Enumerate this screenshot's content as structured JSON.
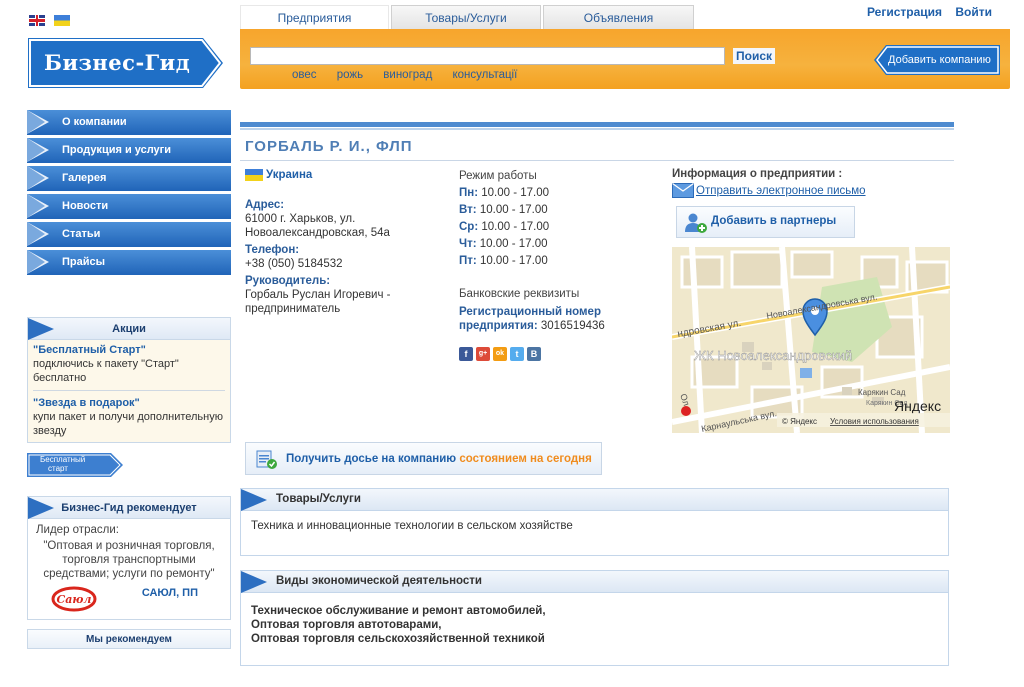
{
  "brand": {
    "name": "Бизнес-Гид"
  },
  "tabs": [
    {
      "label": "Предприятия",
      "active": true
    },
    {
      "label": "Товары/Услуги",
      "active": false
    },
    {
      "label": "Объявления",
      "active": false
    }
  ],
  "top_links": {
    "register": "Регистрация",
    "login": "Войти"
  },
  "search": {
    "value": "",
    "button": "Поиск",
    "hints": [
      "овес",
      "рожь",
      "виноград",
      "консультації"
    ]
  },
  "add_company": "Добавить компанию",
  "menu": [
    "О компании",
    "Продукция и услуги",
    "Галерея",
    "Новости",
    "Статьи",
    "Прайсы"
  ],
  "promos": {
    "title": "Акции",
    "items": [
      {
        "title": "\"Бесплатный Старт\"",
        "text": "подключись к пакету \"Старт\" бесплатно"
      },
      {
        "title": "\"Звезда в подарок\"",
        "text": "купи пакет и получи дополнительную звезду"
      }
    ]
  },
  "free_start": {
    "line1": "Бесплатный",
    "line2": "старт"
  },
  "recommends": {
    "title": "Бизнес-Гид рекомендует",
    "leader": "Лидер отрасли:",
    "quote": "\"Оптовая и розничная торговля, торговля транспортными средствами; услуги по ремонту\"",
    "company": "САЮЛ, ПП",
    "logo_text": "Саюл"
  },
  "we_recommend": "Мы рекомендуем",
  "company": {
    "title": "ГОРБАЛЬ Р. И., ФЛП",
    "country": "Украина",
    "address_label": "Адрес:",
    "address": "61000 г. Харьков, ул. Новоалександровская, 54а",
    "phone_label": "Телефон:",
    "phone": "+38 (050) 5184532",
    "head_label": "Руководитель:",
    "head": "Горбаль Руслан Игоревич - предприниматель"
  },
  "schedule": {
    "title": "Режим работы",
    "days": [
      {
        "day": "Пн:",
        "hours": "10.00 - 17.00"
      },
      {
        "day": "Вт:",
        "hours": "10.00 - 17.00"
      },
      {
        "day": "Ср:",
        "hours": "10.00 - 17.00"
      },
      {
        "day": "Чт:",
        "hours": "10.00 - 17.00"
      },
      {
        "day": "Пт:",
        "hours": "10.00 - 17.00"
      }
    ]
  },
  "bank": {
    "title": "Банковские реквизиты",
    "reg_label": "Регистрационный номер предприятия:",
    "reg_value": "3016519436"
  },
  "social": [
    "f",
    "g+",
    "ok",
    "t",
    "B"
  ],
  "info": {
    "title": "Информация о предприятии :",
    "email": "Отправить электронное письмо",
    "partners": "Добавить в партнеры"
  },
  "map": {
    "street1": "Новоалександровська вул.",
    "street2": "ндровская ул.",
    "complex": "ЖК Новоалександровский",
    "street3": "Карнаульська вул.",
    "street4": "Ол",
    "place": "Карякин Сад",
    "place2": "Карякин Сад",
    "brand": "Яндекс",
    "copyright": "© Яндекс",
    "terms": "Условия использования"
  },
  "dossier": {
    "part1": "Получить досье на компанию",
    "part2": "состоянием на сегодня"
  },
  "goods": {
    "title": "Товары/Услуги",
    "text": "Техника и инновационные технологии в сельском хозяйстве"
  },
  "activities": {
    "title": "Виды экономической деятельности",
    "items": [
      "Техническое обслуживание и ремонт автомобилей,",
      "Оптовая торговля автотоварами,",
      "Оптовая торговля сельскохозяйственной техникой"
    ]
  },
  "colors": {
    "accent_orange": "#f7a52c",
    "brand_blue": "#2064b8",
    "link": "#1f5fa8"
  }
}
